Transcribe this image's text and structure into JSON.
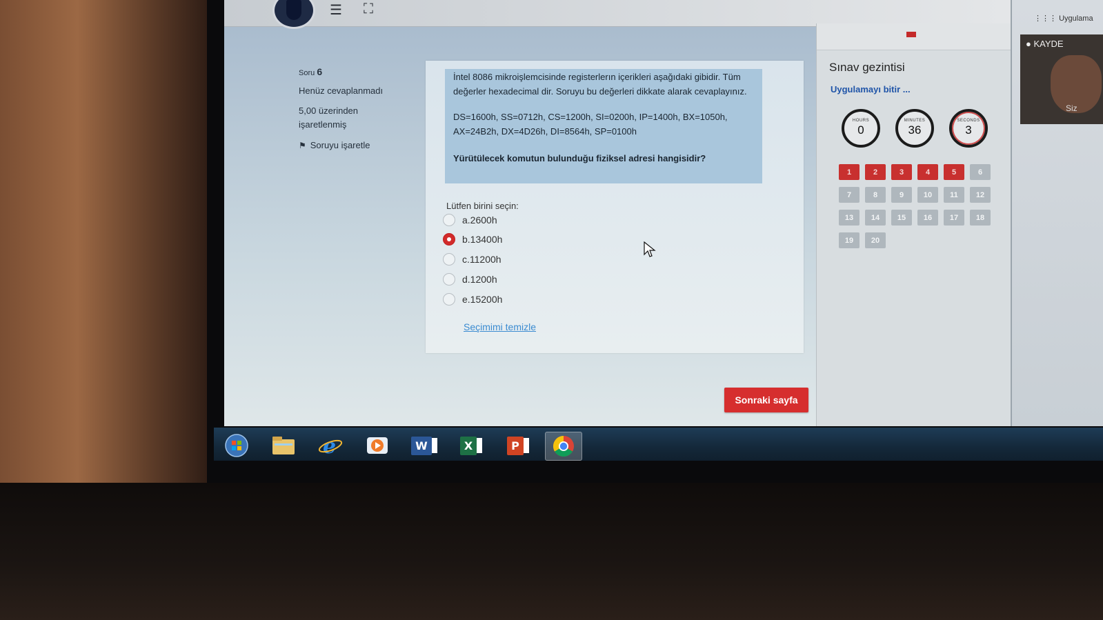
{
  "topbar": {
    "menu_icon": "hamburger-menu-icon",
    "fullscreen_icon": "fullscreen-icon"
  },
  "question_info": {
    "soru_label": "Soru",
    "soru_number": "6",
    "status": "Henüz cevaplanmadı",
    "score_line1": "5,00 üzerinden",
    "score_line2": "işaretlenmiş",
    "flag_label": "Soruyu işaretle"
  },
  "question": {
    "para1": "İntel 8086 mikroişlemcisinde registerlerın içerikleri aşağıdaki gibidir. Tüm değerler hexadecimal dir. Soruyu bu değerleri dikkate alarak cevaplayınız.",
    "para2": "DS=1600h, SS=0712h, CS=1200h, SI=0200h, IP=1400h, BX=1050h, AX=24B2h, DX=4D26h, DI=8564h, SP=0100h",
    "para3": "Yürütülecek komutun bulunduğu fiziksel adresi hangisidir?",
    "prompt": "Lütfen birini seçin:",
    "options": [
      {
        "label": "a.2600h",
        "selected": false
      },
      {
        "label": "b.13400h",
        "selected": true
      },
      {
        "label": "c.11200h",
        "selected": false
      },
      {
        "label": "d.1200h",
        "selected": false
      },
      {
        "label": "e.15200h",
        "selected": false
      }
    ],
    "clear_link": "Seçimimi temizle"
  },
  "next_button": "Sonraki sayfa",
  "nav": {
    "title": "Sınav gezintisi",
    "finish_link": "Uygulamayı bitir ...",
    "timer": {
      "hours_label": "HOURS",
      "hours": "0",
      "minutes_label": "MINUTES",
      "minutes": "36",
      "seconds_label": "SECONDS",
      "seconds": "3"
    },
    "questions": [
      "1",
      "2",
      "3",
      "4",
      "5",
      "6",
      "7",
      "8",
      "9",
      "10",
      "11",
      "12",
      "13",
      "14",
      "15",
      "16",
      "17",
      "18",
      "19",
      "20"
    ],
    "answered_count": 5
  },
  "side": {
    "apps_label": "Uygulama",
    "record_label": "KAYDE",
    "participant_label": "Siz"
  },
  "taskbar": {
    "items": [
      "start-orb",
      "file-explorer",
      "internet-explorer",
      "media-player",
      "word",
      "excel",
      "powerpoint",
      "chrome"
    ],
    "word_letter": "W",
    "excel_letter": "X",
    "ppt_letter": "P",
    "accent_colors": {
      "word": "#2b5797",
      "excel": "#1e7145",
      "ppt": "#d04423",
      "chrome_red": "#db4437",
      "chrome_yellow": "#f4c20d",
      "chrome_green": "#0f9d58"
    }
  },
  "colors": {
    "accent_red": "#d62e2e",
    "answered": "#c8302f",
    "unanswered": "#afb7bd",
    "link_blue": "#3a8bd1"
  }
}
